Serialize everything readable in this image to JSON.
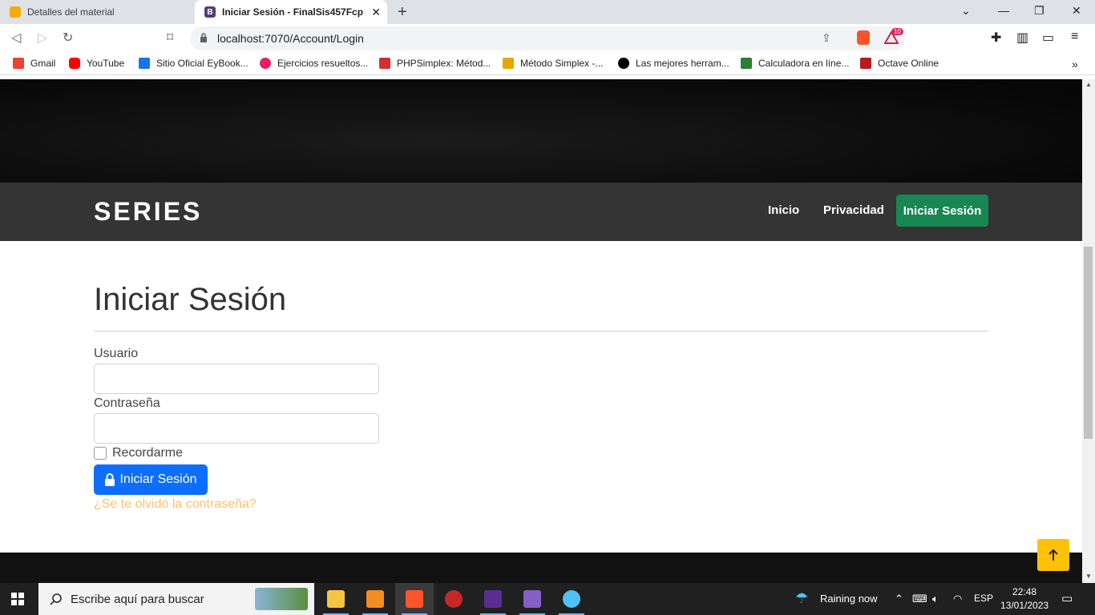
{
  "browser": {
    "tabs": [
      {
        "title": "Detalles del material",
        "active": false,
        "icon": "google-classroom-icon",
        "color": "#f9ab00"
      },
      {
        "title": "Iniciar Sesión - FinalSis457Fcp",
        "active": true,
        "icon": "bootstrap-icon",
        "color": "#563d7c"
      }
    ],
    "url": "localhost:7070/Account/Login",
    "extension_badge": "10",
    "bookmarks": [
      {
        "label": "Gmail",
        "icon": "gmail-icon",
        "color": "#ea4335"
      },
      {
        "label": "YouTube",
        "icon": "youtube-icon",
        "color": "#ff0000"
      },
      {
        "label": "Sitio Oficial EyBook...",
        "icon": "eybook-icon",
        "color": "#1a73e8"
      },
      {
        "label": "Ejercicios resueltos...",
        "icon": "ejercicios-icon",
        "color": "#e91e63"
      },
      {
        "label": "PHPSimplex: Métod...",
        "icon": "phpsimplex-icon",
        "color": "#d32f2f"
      },
      {
        "label": "Método Simplex -...",
        "icon": "pencil-icon",
        "color": "#e6a700"
      },
      {
        "label": "Las mejores herram...",
        "icon": "g-icon",
        "color": "#000000"
      },
      {
        "label": "Calculadora en líne...",
        "icon": "calculator-icon",
        "color": "#2e7d32"
      },
      {
        "label": "Octave Online",
        "icon": "octave-icon",
        "color": "#b71c1c"
      }
    ]
  },
  "site": {
    "brand": "SERIES",
    "nav": {
      "home": "Inicio",
      "privacy": "Privacidad",
      "login": "Iniciar Sesión"
    },
    "colors": {
      "navbar": "#343434",
      "login_button": "#198754",
      "primary": "#0d6efd",
      "link": "#ffc069",
      "to_top": "#ffc107"
    }
  },
  "form": {
    "title": "Iniciar Sesión",
    "username_label": "Usuario",
    "username_value": "",
    "password_label": "Contraseña",
    "password_value": "",
    "remember_label": "Recordarme",
    "remember_checked": false,
    "submit_label": "Iniciar Sesión",
    "forgot_link": "¿Se te olvidó la contraseña?"
  },
  "taskbar": {
    "search_placeholder": "Escribe aquí para buscar",
    "weather": "Raining now",
    "language": "ESP",
    "time": "22:48",
    "date": "13/01/2023"
  }
}
